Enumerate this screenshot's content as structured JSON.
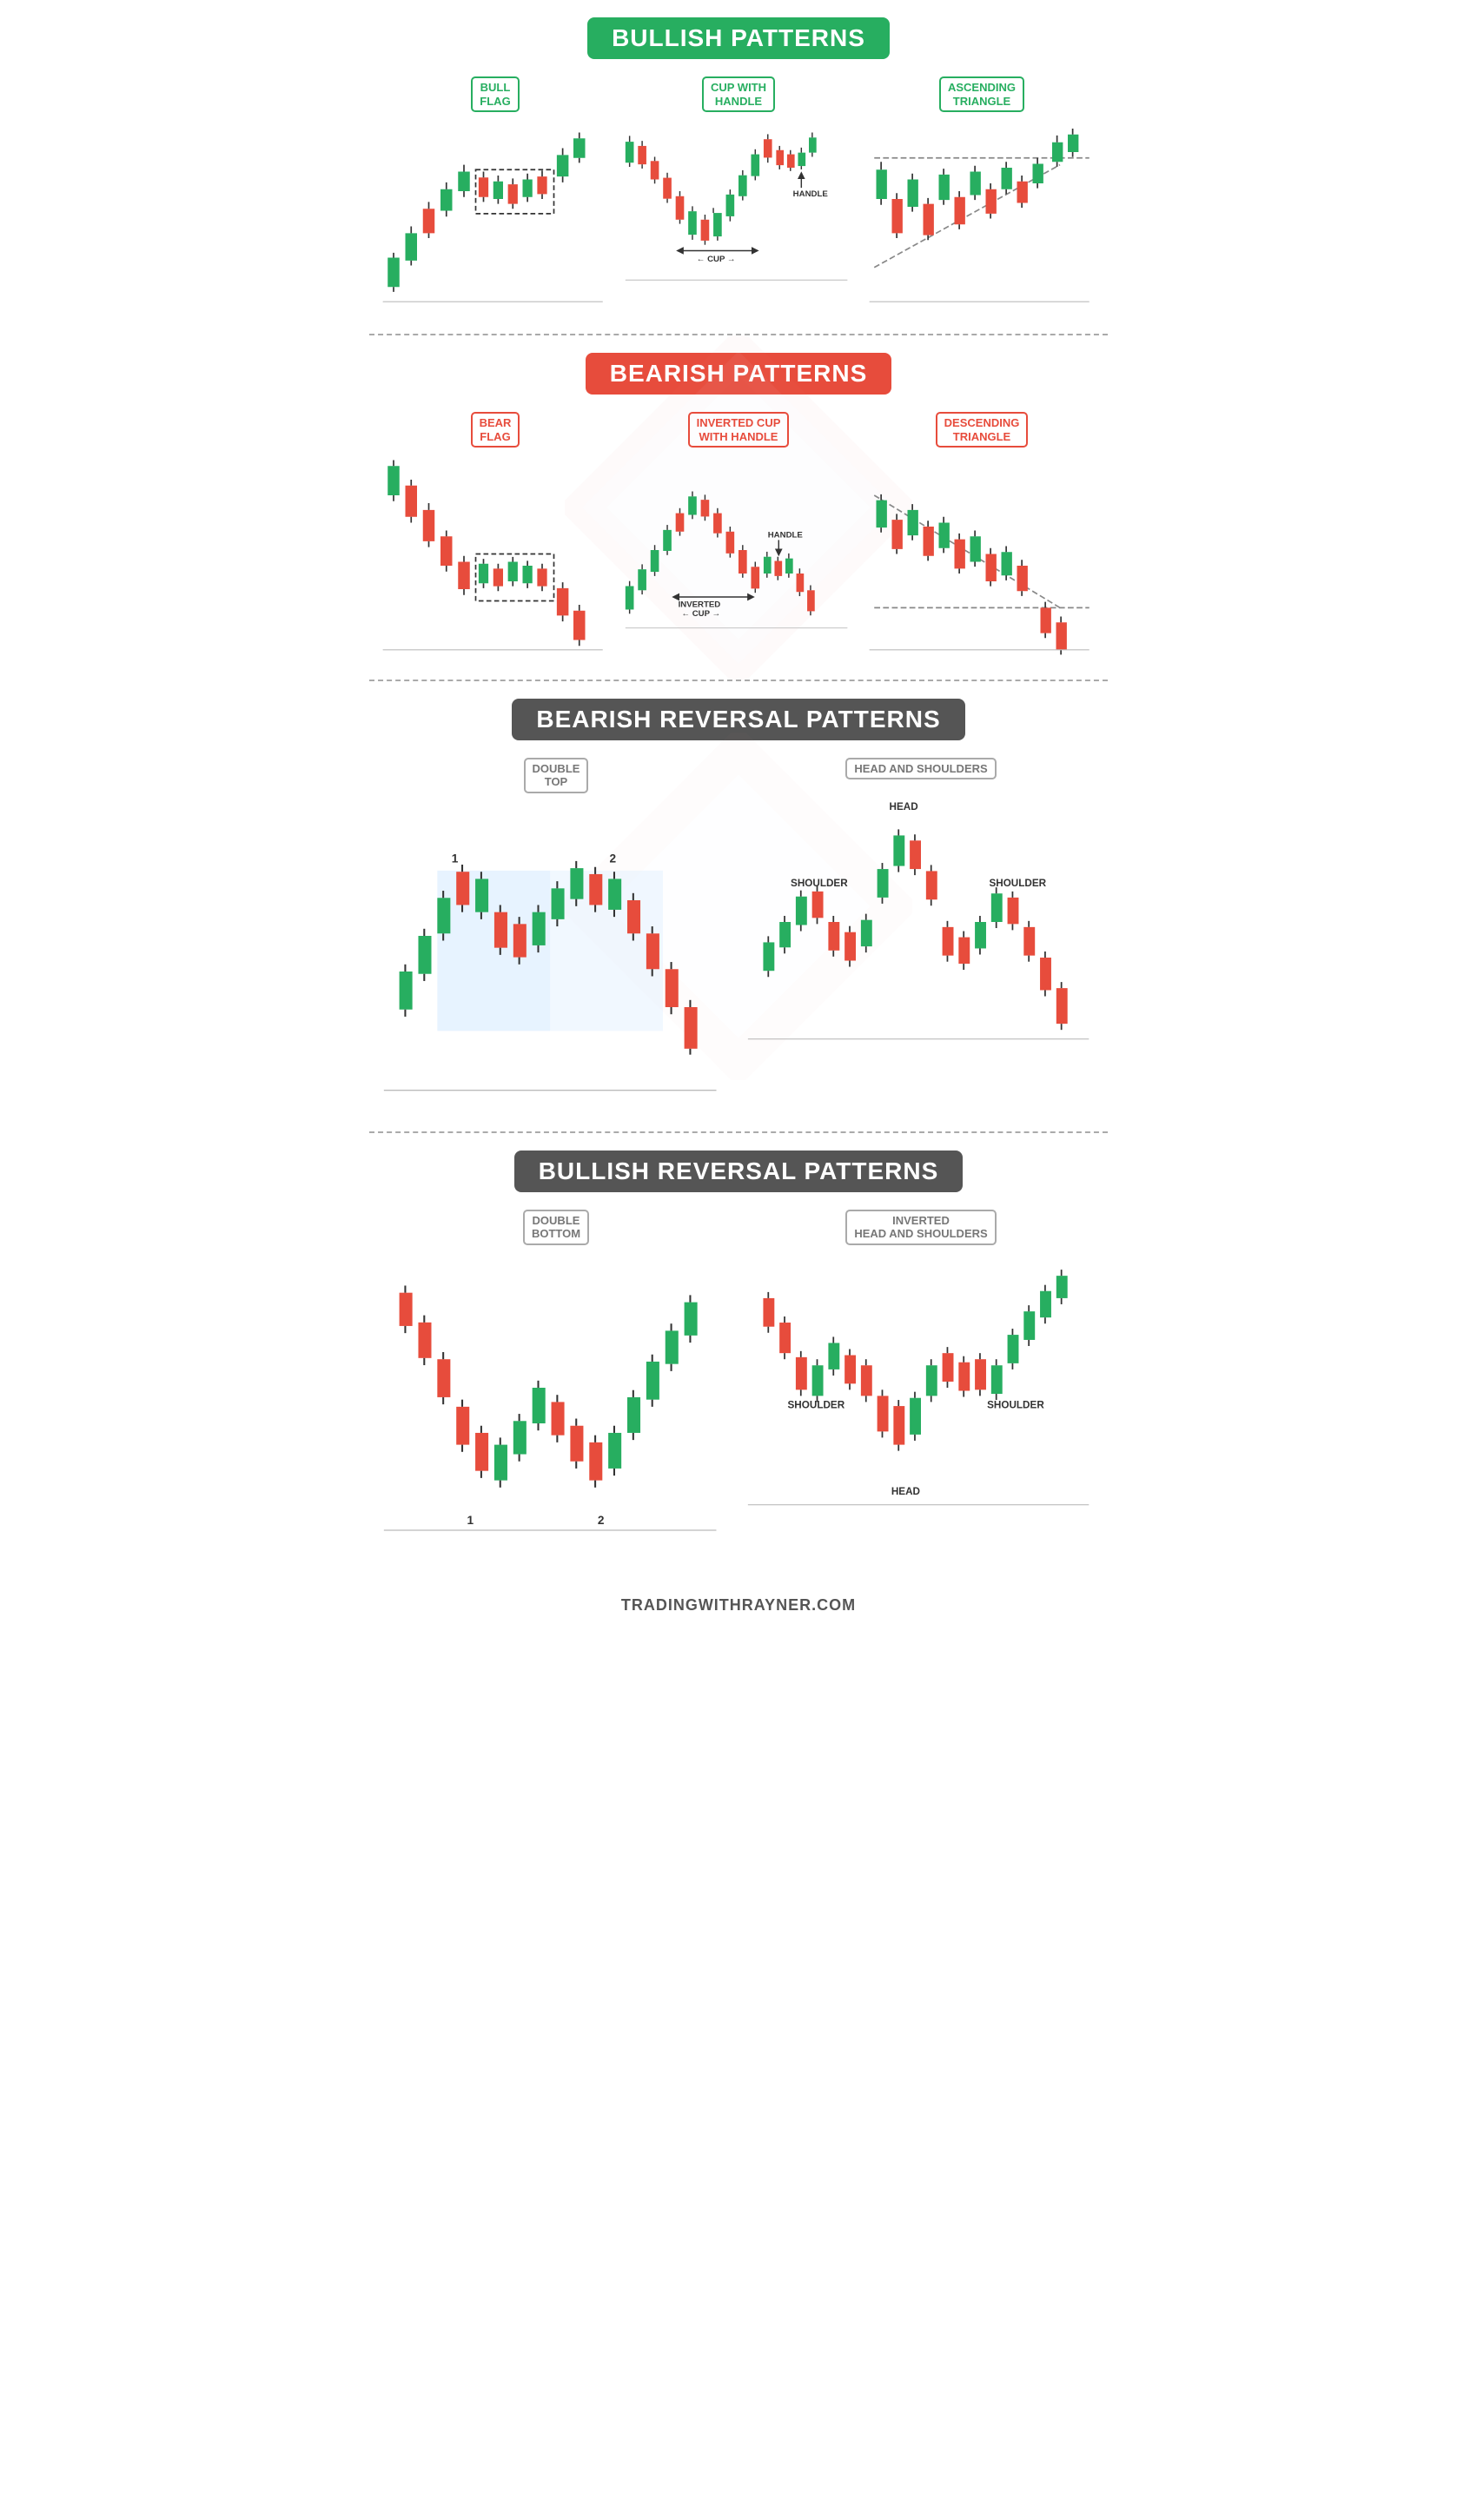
{
  "sections": {
    "bullish": {
      "header": "BULLISH PATTERNS",
      "header_color": "green",
      "patterns": [
        {
          "label": "BULL\nFLAG",
          "color": "green"
        },
        {
          "label": "CUP WITH\nHANDLE",
          "color": "green"
        },
        {
          "label": "ASCENDING\nTRIANGLE",
          "color": "green"
        }
      ]
    },
    "bearish": {
      "header": "BEARISH PATTERNS",
      "header_color": "orange",
      "patterns": [
        {
          "label": "BEAR\nFLAG",
          "color": "orange"
        },
        {
          "label": "INVERTED CUP\nWITH HANDLE",
          "color": "orange"
        },
        {
          "label": "DESCENDING\nTRIANGLE",
          "color": "orange"
        }
      ]
    },
    "bearish_reversal": {
      "header": "BEARISH REVERSAL PATTERNS",
      "header_color": "gray",
      "patterns": [
        {
          "label": "DOUBLE\nTOP",
          "color": "gray"
        },
        {
          "label": "HEAD AND SHOULDERS",
          "color": "gray"
        }
      ]
    },
    "bullish_reversal": {
      "header": "BULLISH REVERSAL PATTERNS",
      "header_color": "gray",
      "patterns": [
        {
          "label": "DOUBLE\nBOTTOM",
          "color": "gray"
        },
        {
          "label": "INVERTED\nHEAD AND SHOULDERS",
          "color": "gray"
        }
      ]
    }
  },
  "footer": {
    "text": "TRADINGWITHRAYNER.COM"
  },
  "colors": {
    "green_candle": "#27ae60",
    "red_candle": "#e74c3c",
    "green_border": "#27ae60",
    "orange_border": "#e74c3c"
  }
}
